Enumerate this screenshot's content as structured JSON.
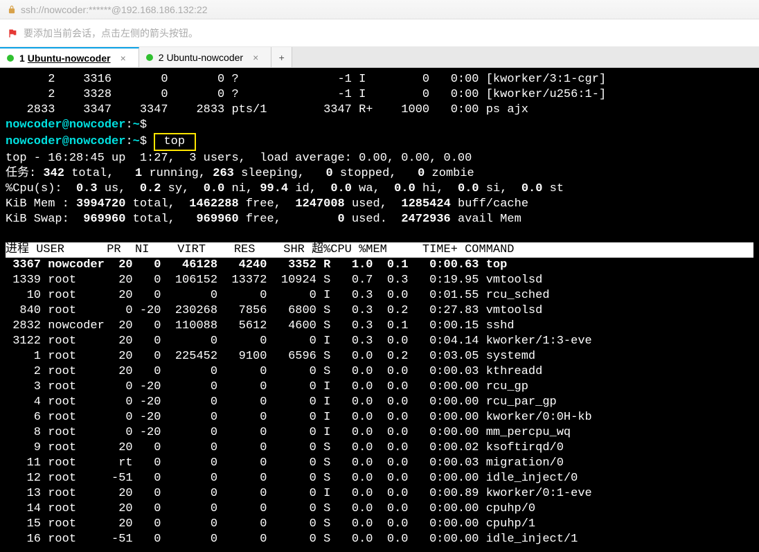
{
  "address": "ssh://nowcoder:******@192.168.186.132:22",
  "hint": "要添加当前会话，点击左侧的箭头按钮。",
  "tabs": [
    {
      "num": "1",
      "title": "Ubuntu-nowcoder",
      "active": true
    },
    {
      "num": "2",
      "title": "Ubuntu-nowcoder",
      "active": false
    }
  ],
  "pre_rows": [
    "      2    3316       0       0 ?              -1 I        0   0:00 [kworker/3:1-cgr]",
    "      2    3328       0       0 ?              -1 I        0   0:00 [kworker/u256:1-]",
    "   2833    3347    3347    2833 pts/1        3347 R+    1000   0:00 ps ajx"
  ],
  "prompt1_user": "nowcoder@nowcoder",
  "prompt1_path": "~",
  "prompt2_user": "nowcoder@nowcoder",
  "prompt2_path": "~",
  "typed_cmd": " top ",
  "top_summary": [
    {
      "prefix": "top - 16:28:45 up  1:27,  3 users,  load average: 0.00, 0.00, 0.00"
    },
    {
      "raw_segments": [
        "任务:",
        " 342 ",
        "total,   ",
        "1 ",
        "running, ",
        "263 ",
        "sleeping,   ",
        "0 ",
        "stopped,   ",
        "0 ",
        "zombie"
      ]
    },
    {
      "raw_segments": [
        "%Cpu(s):  ",
        "0.3 ",
        "us,  ",
        "0.2 ",
        "sy,  ",
        "0.0 ",
        "ni, ",
        "99.4 ",
        "id,  ",
        "0.0 ",
        "wa,  ",
        "0.0 ",
        "hi,  ",
        "0.0 ",
        "si,  ",
        "0.0 ",
        "st"
      ]
    },
    {
      "raw_segments": [
        "KiB Mem : ",
        "3994720 ",
        "total,  ",
        "1462288 ",
        "free,  ",
        "1247008 ",
        "used,  ",
        "1285424 ",
        "buff/cache"
      ]
    },
    {
      "raw_segments": [
        "KiB Swap:  ",
        "969960 ",
        "total,   ",
        "969960 ",
        "free,        ",
        "0 ",
        "used.  ",
        "2472936 ",
        "avail Mem"
      ]
    }
  ],
  "columns_header": "进程 USER      PR  NI    VIRT    RES    SHR 超%CPU %MEM     TIME+ COMMAND                                        ",
  "processes": [
    {
      "pid": "3367",
      "user": "nowcoder",
      "pr": "20",
      "ni": "0",
      "virt": "46128",
      "res": "4240",
      "shr": "3352",
      "s": "R",
      "cpu": "1.0",
      "mem": "0.1",
      "time": "0:00.63",
      "cmd": "top",
      "bold": true
    },
    {
      "pid": "1339",
      "user": "root",
      "pr": "20",
      "ni": "0",
      "virt": "106152",
      "res": "13372",
      "shr": "10924",
      "s": "S",
      "cpu": "0.7",
      "mem": "0.3",
      "time": "0:19.95",
      "cmd": "vmtoolsd"
    },
    {
      "pid": "10",
      "user": "root",
      "pr": "20",
      "ni": "0",
      "virt": "0",
      "res": "0",
      "shr": "0",
      "s": "I",
      "cpu": "0.3",
      "mem": "0.0",
      "time": "0:01.55",
      "cmd": "rcu_sched"
    },
    {
      "pid": "840",
      "user": "root",
      "pr": "0",
      "ni": "-20",
      "virt": "230268",
      "res": "7856",
      "shr": "6800",
      "s": "S",
      "cpu": "0.3",
      "mem": "0.2",
      "time": "0:27.83",
      "cmd": "vmtoolsd"
    },
    {
      "pid": "2832",
      "user": "nowcoder",
      "pr": "20",
      "ni": "0",
      "virt": "110088",
      "res": "5612",
      "shr": "4600",
      "s": "S",
      "cpu": "0.3",
      "mem": "0.1",
      "time": "0:00.15",
      "cmd": "sshd"
    },
    {
      "pid": "3122",
      "user": "root",
      "pr": "20",
      "ni": "0",
      "virt": "0",
      "res": "0",
      "shr": "0",
      "s": "I",
      "cpu": "0.3",
      "mem": "0.0",
      "time": "0:04.14",
      "cmd": "kworker/1:3-eve"
    },
    {
      "pid": "1",
      "user": "root",
      "pr": "20",
      "ni": "0",
      "virt": "225452",
      "res": "9100",
      "shr": "6596",
      "s": "S",
      "cpu": "0.0",
      "mem": "0.2",
      "time": "0:03.05",
      "cmd": "systemd"
    },
    {
      "pid": "2",
      "user": "root",
      "pr": "20",
      "ni": "0",
      "virt": "0",
      "res": "0",
      "shr": "0",
      "s": "S",
      "cpu": "0.0",
      "mem": "0.0",
      "time": "0:00.03",
      "cmd": "kthreadd"
    },
    {
      "pid": "3",
      "user": "root",
      "pr": "0",
      "ni": "-20",
      "virt": "0",
      "res": "0",
      "shr": "0",
      "s": "I",
      "cpu": "0.0",
      "mem": "0.0",
      "time": "0:00.00",
      "cmd": "rcu_gp"
    },
    {
      "pid": "4",
      "user": "root",
      "pr": "0",
      "ni": "-20",
      "virt": "0",
      "res": "0",
      "shr": "0",
      "s": "I",
      "cpu": "0.0",
      "mem": "0.0",
      "time": "0:00.00",
      "cmd": "rcu_par_gp"
    },
    {
      "pid": "6",
      "user": "root",
      "pr": "0",
      "ni": "-20",
      "virt": "0",
      "res": "0",
      "shr": "0",
      "s": "I",
      "cpu": "0.0",
      "mem": "0.0",
      "time": "0:00.00",
      "cmd": "kworker/0:0H-kb"
    },
    {
      "pid": "8",
      "user": "root",
      "pr": "0",
      "ni": "-20",
      "virt": "0",
      "res": "0",
      "shr": "0",
      "s": "I",
      "cpu": "0.0",
      "mem": "0.0",
      "time": "0:00.00",
      "cmd": "mm_percpu_wq"
    },
    {
      "pid": "9",
      "user": "root",
      "pr": "20",
      "ni": "0",
      "virt": "0",
      "res": "0",
      "shr": "0",
      "s": "S",
      "cpu": "0.0",
      "mem": "0.0",
      "time": "0:00.02",
      "cmd": "ksoftirqd/0"
    },
    {
      "pid": "11",
      "user": "root",
      "pr": "rt",
      "ni": "0",
      "virt": "0",
      "res": "0",
      "shr": "0",
      "s": "S",
      "cpu": "0.0",
      "mem": "0.0",
      "time": "0:00.03",
      "cmd": "migration/0"
    },
    {
      "pid": "12",
      "user": "root",
      "pr": "-51",
      "ni": "0",
      "virt": "0",
      "res": "0",
      "shr": "0",
      "s": "S",
      "cpu": "0.0",
      "mem": "0.0",
      "time": "0:00.00",
      "cmd": "idle_inject/0"
    },
    {
      "pid": "13",
      "user": "root",
      "pr": "20",
      "ni": "0",
      "virt": "0",
      "res": "0",
      "shr": "0",
      "s": "I",
      "cpu": "0.0",
      "mem": "0.0",
      "time": "0:00.89",
      "cmd": "kworker/0:1-eve"
    },
    {
      "pid": "14",
      "user": "root",
      "pr": "20",
      "ni": "0",
      "virt": "0",
      "res": "0",
      "shr": "0",
      "s": "S",
      "cpu": "0.0",
      "mem": "0.0",
      "time": "0:00.00",
      "cmd": "cpuhp/0"
    },
    {
      "pid": "15",
      "user": "root",
      "pr": "20",
      "ni": "0",
      "virt": "0",
      "res": "0",
      "shr": "0",
      "s": "S",
      "cpu": "0.0",
      "mem": "0.0",
      "time": "0:00.00",
      "cmd": "cpuhp/1"
    },
    {
      "pid": "16",
      "user": "root",
      "pr": "-51",
      "ni": "0",
      "virt": "0",
      "res": "0",
      "shr": "0",
      "s": "S",
      "cpu": "0.0",
      "mem": "0.0",
      "time": "0:00.00",
      "cmd": "idle_inject/1"
    }
  ]
}
